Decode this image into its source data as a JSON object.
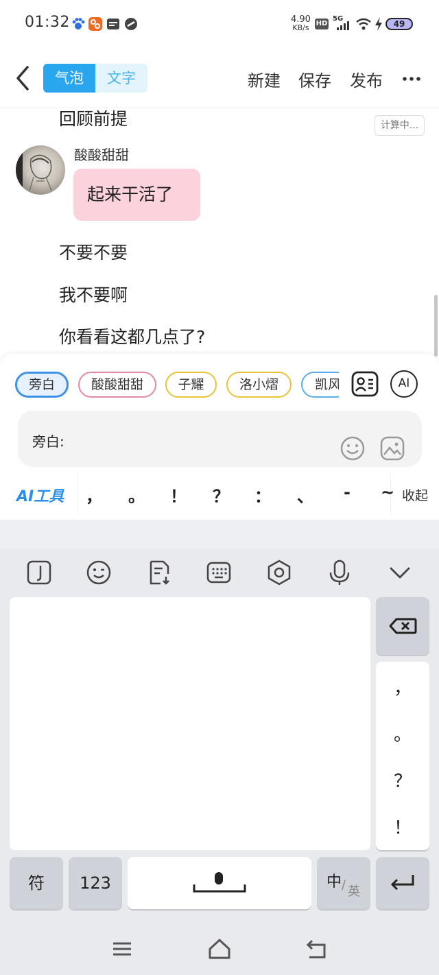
{
  "status_bar": {
    "time": "01:32",
    "net_speed_value": "4.90",
    "net_speed_unit": "KB/s",
    "hd": "HD",
    "network": "5G",
    "battery": "49"
  },
  "header": {
    "tabs": [
      {
        "label": "气泡",
        "active": true
      },
      {
        "label": "文字",
        "active": false
      }
    ],
    "actions": {
      "new": "新建",
      "save": "保存",
      "publish": "发布"
    },
    "more": "···"
  },
  "content": {
    "narration_top": "回顾前提",
    "calc_badge": "计算中...",
    "message": {
      "name": "酸酸甜甜",
      "text": "起来干活了"
    },
    "narrations": [
      "不要不要",
      "我不要啊",
      "你看看这都几点了?"
    ]
  },
  "editor": {
    "roles": [
      "旁白",
      "酸酸甜甜",
      "子耀",
      "洛小熠",
      "凯风"
    ],
    "ai_button": "AI",
    "input_label": "旁白:",
    "input_value": "",
    "ai_tools": "AI工具",
    "punctuation": [
      "，",
      "。",
      "！",
      "？",
      "：",
      "、",
      "-",
      "~"
    ],
    "collapse": "收起"
  },
  "keyboard": {
    "punct_column": [
      "，",
      "。",
      "？",
      "！"
    ],
    "sym_key": "符",
    "num_key": "123",
    "lang_main": "中",
    "lang_sub": "英"
  },
  "colors": {
    "accent_blue": "#29a6ee",
    "bubble_pink": "#fcd3dc",
    "keyboard_bg": "#e9eaee"
  }
}
